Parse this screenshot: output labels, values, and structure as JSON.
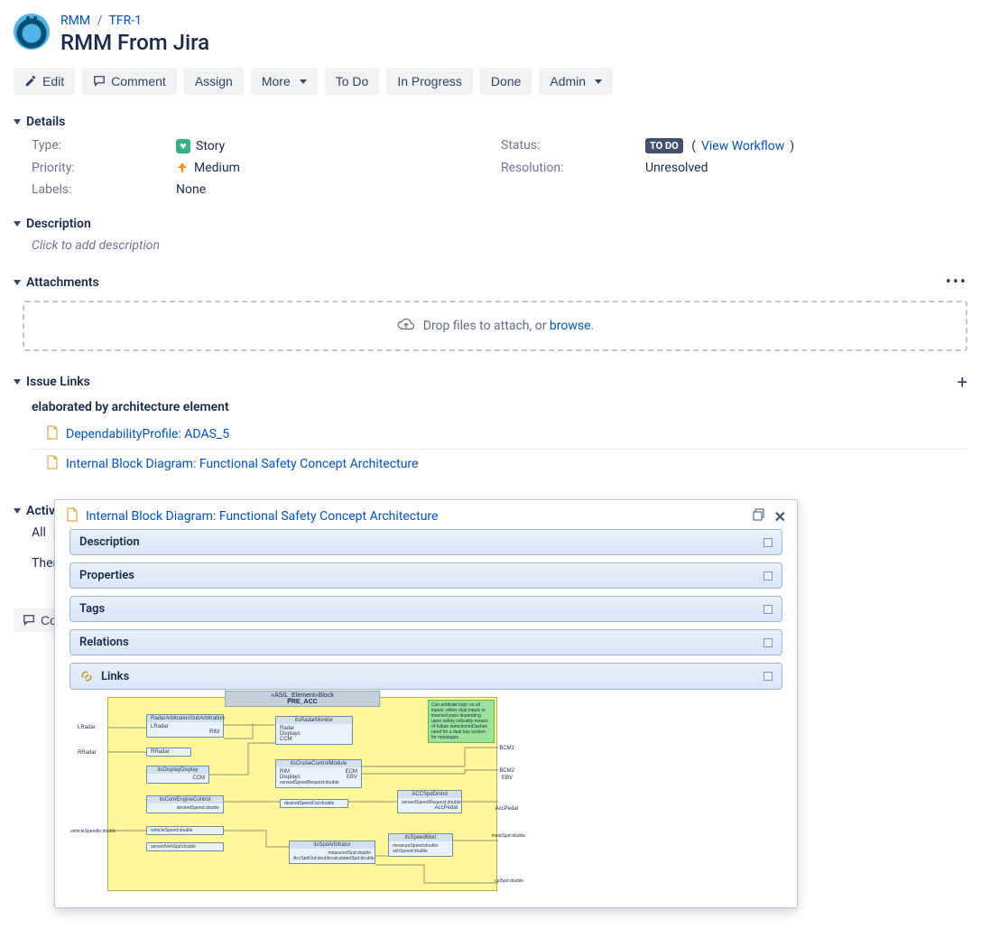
{
  "breadcrumb": {
    "project": "RMM",
    "issue": "TFR-1"
  },
  "page_title": "RMM From Jira",
  "toolbar": {
    "edit": "Edit",
    "comment": "Comment",
    "assign": "Assign",
    "more": "More",
    "todo": "To Do",
    "inprogress": "In Progress",
    "done": "Done",
    "admin": "Admin"
  },
  "sections": {
    "details": "Details",
    "description": "Description",
    "attachments": "Attachments",
    "issue_links": "Issue Links",
    "activity": "Activity"
  },
  "details": {
    "labels": {
      "type": "Type:",
      "priority": "Priority:",
      "labels": "Labels:",
      "status": "Status:",
      "resolution": "Resolution:"
    },
    "values": {
      "type": "Story",
      "priority": "Medium",
      "labels": "None",
      "status": "TO DO",
      "view_workflow": "View Workflow",
      "resolution": "Unresolved"
    }
  },
  "description_placeholder": "Click to add description",
  "attachments": {
    "drop_text": "Drop files to attach, or ",
    "browse": "browse",
    "period": "."
  },
  "links": {
    "subheading": "elaborated by architecture element",
    "items": [
      "DependabilityProfile: ADAS_5",
      "Internal Block Diagram: Functional Safety Concept Architecture"
    ]
  },
  "activity": {
    "tabs_all": "All",
    "line": "Ther"
  },
  "footer": {
    "comment_prefix": "Co"
  },
  "popup": {
    "title": "Internal Block Diagram: Functional Safety Concept Architecture",
    "panels": {
      "description": "Description",
      "properties": "Properties",
      "tags": "Tags",
      "relations": "Relations",
      "links": "Links"
    },
    "diagram": {
      "frame_label_top": "«ASIL_Element»Block",
      "frame_label_name": "PRE_ACC",
      "note": "Can arbitrate logic on all inputs; either dual inputs or inverted pairs depending upon safety criticality means of failure detection\\nDashes need for a dual bus system for messages",
      "blocks": {
        "radarArb": "RadarArbitrationSubArbitration",
        "radarMon": "itsRadarMonitor",
        "displayDisp": "itsDisplayDisplay",
        "cruise": "itsCruiseControlModule",
        "engine": "itsComEngineControl",
        "accSpd": "ACCSpdDmnd",
        "spdArb": "itsSpdArbitrator",
        "spdMon": "itsSpeedMon"
      },
      "ports": {
        "lRadar": "LRadar",
        "rRadar": "RRadar",
        "rm": "RIM",
        "radar": "Radar",
        "displays": "Displays",
        "ccm": "CCM",
        "ecm": "ECM",
        "ebv": "EBV",
        "bcm1": "BCM1",
        "bcm2": "BCM2",
        "ebv2": "EBV",
        "accPedal": "AccPedal",
        "sensedSpdReq": "sensedSpeedRequest:double",
        "desiredSpd": "desiredSpeed:double",
        "desiredSpdOut": "desiredSpeedOut:double",
        "vehSpdIn": "vehicleSpeedIn:double",
        "vehSpd": "vehicleSpeed:double",
        "sensedVehSpd": "sensedVehSpd:double",
        "accSetOut": "AccSpdOut:double",
        "calcSpd": "calculatedSpd:double",
        "measSpd": "measuredSpd:double",
        "measSpeed": "measureSpeed:double",
        "vehSpdDbl": "vehSpeed:double",
        "measSpdDbl": "measSpd:double",
        "calSpdDbl": "calSpd:double"
      }
    }
  }
}
